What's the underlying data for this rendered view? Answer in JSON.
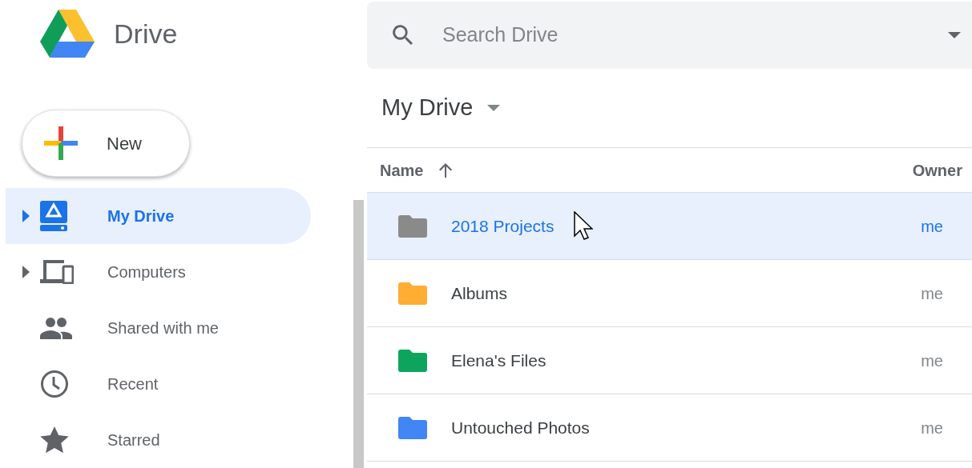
{
  "app": {
    "title": "Drive"
  },
  "new_button": {
    "label": "New"
  },
  "sidebar": {
    "items": [
      {
        "label": "My Drive",
        "kind": "drive",
        "expandable": true,
        "selected": true
      },
      {
        "label": "Computers",
        "kind": "computers",
        "expandable": true,
        "selected": false
      },
      {
        "label": "Shared with me",
        "kind": "shared",
        "expandable": false,
        "selected": false
      },
      {
        "label": "Recent",
        "kind": "recent",
        "expandable": false,
        "selected": false
      },
      {
        "label": "Starred",
        "kind": "starred",
        "expandable": false,
        "selected": false
      }
    ]
  },
  "search": {
    "placeholder": "Search Drive"
  },
  "location": {
    "title": "My Drive"
  },
  "table": {
    "columns": [
      "Name",
      "Owner"
    ],
    "rows": [
      {
        "name": "2018 Projects",
        "owner": "me",
        "color": "#8a8a8a",
        "selected": true
      },
      {
        "name": "Albums",
        "owner": "me",
        "color": "#ffad33",
        "selected": false
      },
      {
        "name": "Elena's Files",
        "owner": "me",
        "color": "#0da55e",
        "selected": false
      },
      {
        "name": "Untouched Photos",
        "owner": "me",
        "color": "#4285f4",
        "selected": false
      }
    ]
  }
}
